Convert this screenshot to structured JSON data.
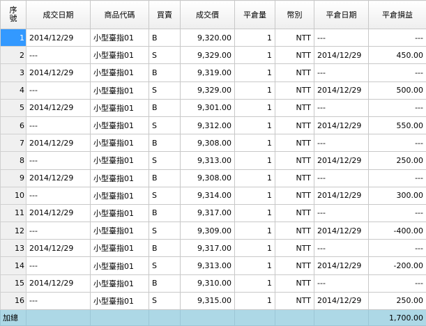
{
  "headers": {
    "seq": "序號",
    "trade_date": "成交日期",
    "product_code": "商品代碼",
    "side": "買賣",
    "price": "成交價",
    "close_qty": "平倉量",
    "currency": "幣別",
    "close_date": "平倉日期",
    "pnl": "平倉損益"
  },
  "rows": [
    {
      "seq": "1",
      "trade_date": "2014/12/29",
      "product": "小型臺指01",
      "side": "B",
      "price": "9,320.00",
      "qty": "1",
      "currency": "NTT",
      "close_date": "---",
      "pnl": "---"
    },
    {
      "seq": "2",
      "trade_date": "---",
      "product": "小型臺指01",
      "side": "S",
      "price": "9,329.00",
      "qty": "1",
      "currency": "NTT",
      "close_date": "2014/12/29",
      "pnl": "450.00"
    },
    {
      "seq": "3",
      "trade_date": "2014/12/29",
      "product": "小型臺指01",
      "side": "B",
      "price": "9,319.00",
      "qty": "1",
      "currency": "NTT",
      "close_date": "---",
      "pnl": "---"
    },
    {
      "seq": "4",
      "trade_date": "---",
      "product": "小型臺指01",
      "side": "S",
      "price": "9,329.00",
      "qty": "1",
      "currency": "NTT",
      "close_date": "2014/12/29",
      "pnl": "500.00"
    },
    {
      "seq": "5",
      "trade_date": "2014/12/29",
      "product": "小型臺指01",
      "side": "B",
      "price": "9,301.00",
      "qty": "1",
      "currency": "NTT",
      "close_date": "---",
      "pnl": "---"
    },
    {
      "seq": "6",
      "trade_date": "---",
      "product": "小型臺指01",
      "side": "S",
      "price": "9,312.00",
      "qty": "1",
      "currency": "NTT",
      "close_date": "2014/12/29",
      "pnl": "550.00"
    },
    {
      "seq": "7",
      "trade_date": "2014/12/29",
      "product": "小型臺指01",
      "side": "B",
      "price": "9,308.00",
      "qty": "1",
      "currency": "NTT",
      "close_date": "---",
      "pnl": "---"
    },
    {
      "seq": "8",
      "trade_date": "---",
      "product": "小型臺指01",
      "side": "S",
      "price": "9,313.00",
      "qty": "1",
      "currency": "NTT",
      "close_date": "2014/12/29",
      "pnl": "250.00"
    },
    {
      "seq": "9",
      "trade_date": "2014/12/29",
      "product": "小型臺指01",
      "side": "B",
      "price": "9,308.00",
      "qty": "1",
      "currency": "NTT",
      "close_date": "---",
      "pnl": "---"
    },
    {
      "seq": "10",
      "trade_date": "---",
      "product": "小型臺指01",
      "side": "S",
      "price": "9,314.00",
      "qty": "1",
      "currency": "NTT",
      "close_date": "2014/12/29",
      "pnl": "300.00"
    },
    {
      "seq": "11",
      "trade_date": "2014/12/29",
      "product": "小型臺指01",
      "side": "B",
      "price": "9,317.00",
      "qty": "1",
      "currency": "NTT",
      "close_date": "---",
      "pnl": "---"
    },
    {
      "seq": "12",
      "trade_date": "---",
      "product": "小型臺指01",
      "side": "S",
      "price": "9,309.00",
      "qty": "1",
      "currency": "NTT",
      "close_date": "2014/12/29",
      "pnl": "-400.00"
    },
    {
      "seq": "13",
      "trade_date": "2014/12/29",
      "product": "小型臺指01",
      "side": "B",
      "price": "9,317.00",
      "qty": "1",
      "currency": "NTT",
      "close_date": "---",
      "pnl": "---"
    },
    {
      "seq": "14",
      "trade_date": "---",
      "product": "小型臺指01",
      "side": "S",
      "price": "9,313.00",
      "qty": "1",
      "currency": "NTT",
      "close_date": "2014/12/29",
      "pnl": "-200.00"
    },
    {
      "seq": "15",
      "trade_date": "2014/12/29",
      "product": "小型臺指01",
      "side": "B",
      "price": "9,310.00",
      "qty": "1",
      "currency": "NTT",
      "close_date": "---",
      "pnl": "---"
    },
    {
      "seq": "16",
      "trade_date": "---",
      "product": "小型臺指01",
      "side": "S",
      "price": "9,315.00",
      "qty": "1",
      "currency": "NTT",
      "close_date": "2014/12/29",
      "pnl": "250.00"
    }
  ],
  "selected_row": 0,
  "footer": {
    "label": "加總",
    "total_pnl": "1,700.00"
  }
}
